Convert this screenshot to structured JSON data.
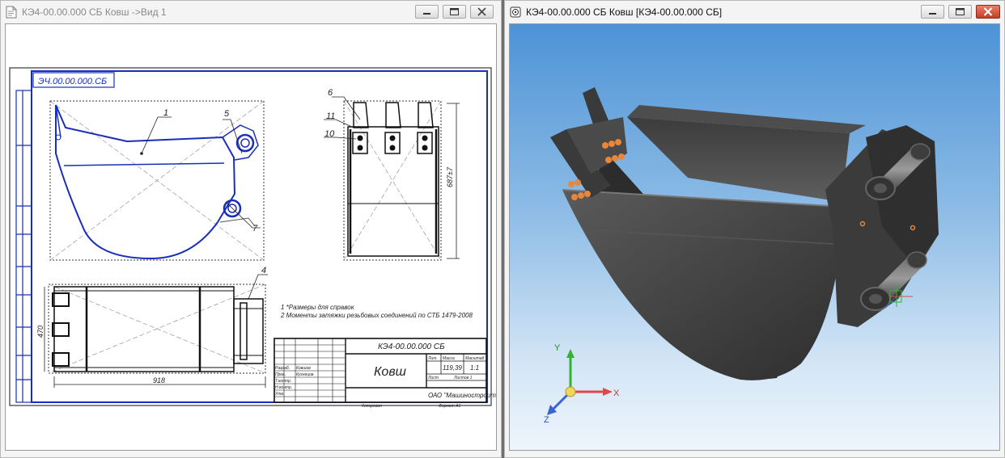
{
  "left_window": {
    "title": "КЭ4-00.00.000 СБ Ковш ->Вид 1",
    "drawing": {
      "stamp_code": "КЭ4-00.00.000 СБ",
      "stamp_title": "Ковш",
      "positions": [
        "1",
        "5",
        "7",
        "6",
        "11",
        "10",
        "4"
      ],
      "dim_height": "687±7",
      "dim_width": "918",
      "dim_side": "470",
      "notes": [
        "1 *Размеры для справок",
        "2 Моменты затяжки резьбовых соединений по СТБ 1479-2008"
      ],
      "stamp_roles": [
        "Разраб.",
        "Пров.",
        "Т.контр.",
        "Н.контр.",
        "Утв."
      ],
      "stamp_names": [
        "Ковшов",
        "Кузнецов"
      ],
      "stamp_headers": [
        "Лит.",
        "Масса",
        "Масштаб"
      ],
      "mass": "119,39",
      "scale": "1:1",
      "sheet": "Лист",
      "sheets": "Листов 1",
      "org": "ОАО \"Машиностроитель\"",
      "copied": "Копировал",
      "format": "Формат A1"
    }
  },
  "right_window": {
    "title": "КЭ4-00.00.000 СБ Ковш [КЭ4-00.00.000 СБ]",
    "axes": {
      "x": "X",
      "y": "Y",
      "z": "Z"
    }
  },
  "colors": {
    "drawing_blue": "#1a2fb8",
    "viewport_sky_top": "#4d93d6",
    "viewport_sky_bottom": "#eef5fc",
    "bucket_body": "#454545",
    "bolt_orange": "#e8873a",
    "axis_x": "#e04848",
    "axis_y": "#33b233",
    "axis_z": "#3a63d8"
  },
  "icons": [
    "document-icon",
    "model-icon",
    "minimize-icon",
    "maximize-icon",
    "close-icon"
  ]
}
